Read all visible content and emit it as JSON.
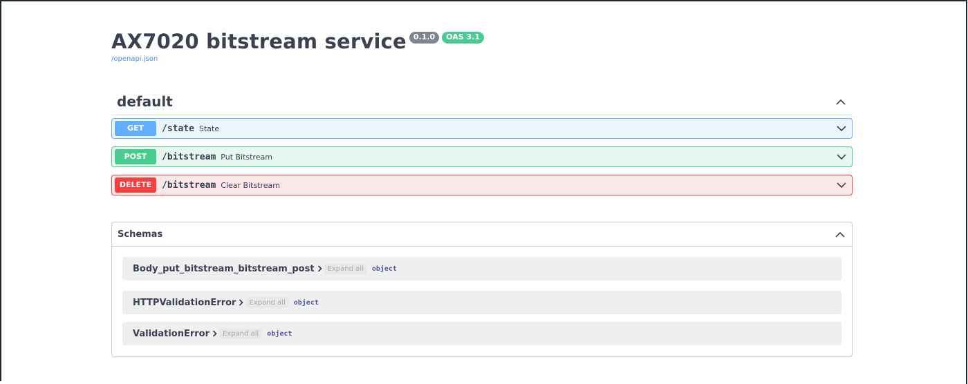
{
  "info": {
    "title": "AX7020 bitstream service",
    "version": "0.1.0",
    "oas": "OAS 3.1",
    "spec_link": "/openapi.json"
  },
  "tag": {
    "name": "default",
    "operations": [
      {
        "method": "GET",
        "path": "/state",
        "summary": "State"
      },
      {
        "method": "POST",
        "path": "/bitstream",
        "summary": "Put Bitstream"
      },
      {
        "method": "DELETE",
        "path": "/bitstream",
        "summary": "Clear Bitstream"
      }
    ]
  },
  "schemas": {
    "title": "Schemas",
    "models": [
      {
        "name": "Body_put_bitstream_bitstream_post",
        "expand_label": "Expand all",
        "type": "object"
      },
      {
        "name": "HTTPValidationError",
        "expand_label": "Expand all",
        "type": "object"
      },
      {
        "name": "ValidationError",
        "expand_label": "Expand all",
        "type": "object"
      }
    ]
  },
  "colors": {
    "get": "#61affe",
    "post": "#49cc90",
    "delete": "#f93e3e",
    "text": "#3b4151",
    "link": "#4990e2"
  },
  "icons": {
    "collapse": "chevron-up-icon",
    "expand": "chevron-down-icon",
    "model_expand": "chevron-right-icon"
  }
}
